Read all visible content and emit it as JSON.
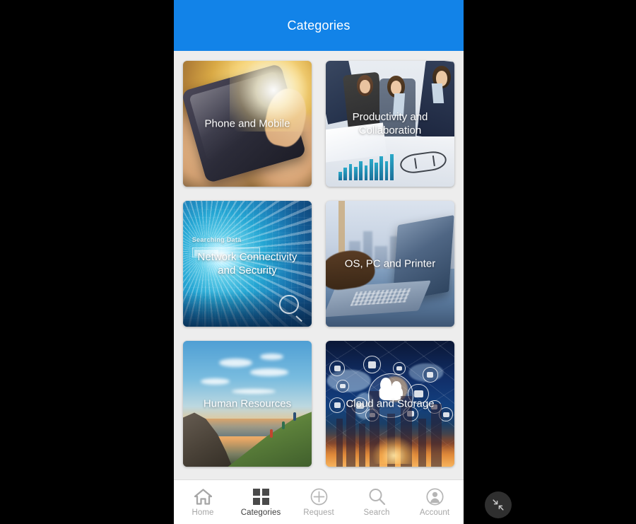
{
  "app": {
    "header": {
      "title": "Categories",
      "background_color": "#1283e8",
      "text_color": "#ffffff"
    },
    "content_background": "#ededed"
  },
  "categories": [
    {
      "label": "Phone and Mobile",
      "art": "phone-in-hands-sunset-photo"
    },
    {
      "label": "Productivity and Collaboration",
      "art": "business-team-meeting-photo"
    },
    {
      "label": "Network Connectivity and Security",
      "art": "cyan-digital-data-burst-photo",
      "overlay_text": "Searching Data"
    },
    {
      "label": "OS, PC and Printer",
      "art": "hand-on-laptop-city-window-photo"
    },
    {
      "label": "Human Resources",
      "art": "hikers-on-hillside-sunset-photo"
    },
    {
      "label": "Cloud and Storage",
      "art": "cloud-network-world-map-photo"
    }
  ],
  "bottom_nav": {
    "active": "Categories",
    "items": [
      {
        "label": "Home",
        "icon": "home-icon",
        "active": false
      },
      {
        "label": "Categories",
        "icon": "grid-icon",
        "active": true
      },
      {
        "label": "Request",
        "icon": "plus-circle-icon",
        "active": false
      },
      {
        "label": "Search",
        "icon": "search-icon",
        "active": false
      },
      {
        "label": "Account",
        "icon": "account-icon",
        "active": false
      }
    ],
    "inactive_color": "#a6a6a6",
    "active_color": "#3d3d3d"
  },
  "floating_button": {
    "icon": "collapse-arrows-icon",
    "background_color": "#2f2f2f"
  }
}
